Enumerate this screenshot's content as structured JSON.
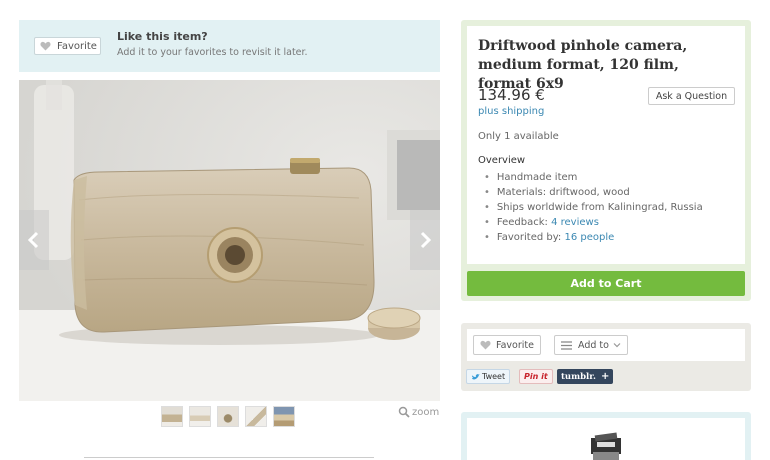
{
  "favorite_banner": {
    "button_label": "Favorite",
    "title": "Like this item?",
    "subtitle": "Add it to your favorites to revisit it later."
  },
  "gallery": {
    "zoom_label": "zoom",
    "thumbnail_count": 5
  },
  "listing": {
    "title": "Driftwood pinhole camera, medium format, 120 film, format 6x9",
    "price": "134.96 €",
    "shipping": "plus shipping",
    "ask_button": "Ask a Question",
    "availability": "Only 1 available",
    "overview_title": "Overview",
    "overview": {
      "handmade": "Handmade item",
      "materials": "Materials: driftwood, wood",
      "ships": "Ships worldwide from Kaliningrad, Russia",
      "feedback_label": "Feedback: ",
      "feedback_link": "4 reviews",
      "favorited_label": "Favorited by: ",
      "favorited_link": "16 people"
    },
    "cart_button": "Add to Cart"
  },
  "social": {
    "favorite_label": "Favorite",
    "add_to_label": "Add to",
    "tweet": "Tweet",
    "pinit": "Pin it",
    "tumblr": "tumblr."
  },
  "colors": {
    "cart_green": "#74bb3e",
    "link_blue": "#3b88b2",
    "banner_blue": "#e2f1f3",
    "info_green": "#e6f0dc"
  }
}
